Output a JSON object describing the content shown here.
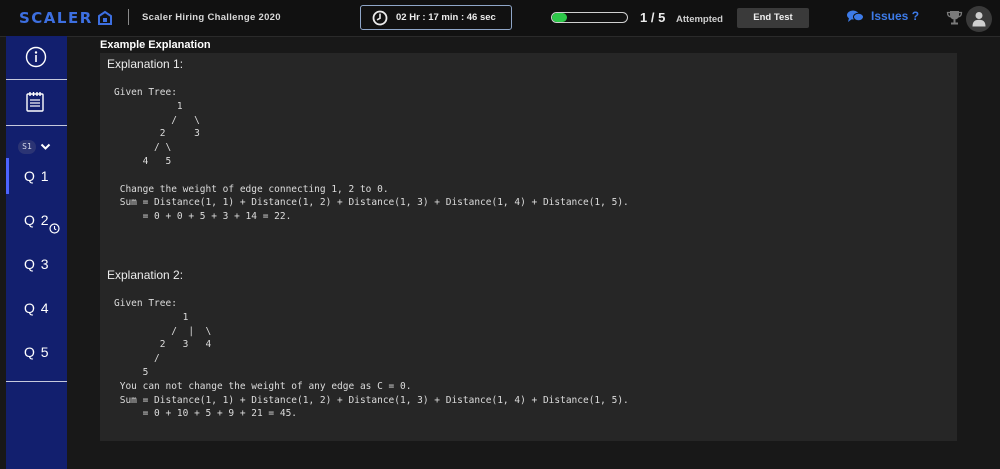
{
  "header": {
    "logo_text": "SCALER",
    "contest_title": "Scaler Hiring Challenge 2020",
    "timer": "02 Hr : 17 min : 46 sec",
    "progress_fraction": 0.2,
    "progress_count": "1 / 5",
    "attempted_label": "Attempted",
    "end_test_label": "End Test",
    "issues_label": "Issues ?",
    "colors": {
      "accent": "#3d6fe0",
      "progress": "#2ec94a",
      "sidebar": "#121f6e"
    }
  },
  "sidebar": {
    "icons": [
      "info-icon",
      "notepad-icon"
    ],
    "section_badge": "S1",
    "questions": [
      {
        "label": "Q 1",
        "active": true,
        "clock": false
      },
      {
        "label": "Q 2",
        "active": false,
        "clock": true
      },
      {
        "label": "Q 3",
        "active": false,
        "clock": false
      },
      {
        "label": "Q 4",
        "active": false,
        "clock": false
      },
      {
        "label": "Q 5",
        "active": false,
        "clock": false
      }
    ]
  },
  "main": {
    "section_title": "Example Explanation",
    "examples": [
      {
        "title": "Explanation 1:",
        "code": "Given Tree:\n           1\n          /   \\\n        2     3\n       / \\\n     4   5\n\n Change the weight of edge connecting 1, 2 to 0.\n Sum = Distance(1, 1) + Distance(1, 2) + Distance(1, 3) + Distance(1, 4) + Distance(1, 5).\n     = 0 + 0 + 5 + 3 + 14 = 22."
      },
      {
        "title": "Explanation 2:",
        "code": "Given Tree:\n            1\n          /  |  \\\n        2   3   4\n       /\n     5\n You can not change the weight of any edge as C = 0.\n Sum = Distance(1, 1) + Distance(1, 2) + Distance(1, 3) + Distance(1, 4) + Distance(1, 5).\n     = 0 + 10 + 5 + 9 + 21 = 45."
      }
    ]
  }
}
